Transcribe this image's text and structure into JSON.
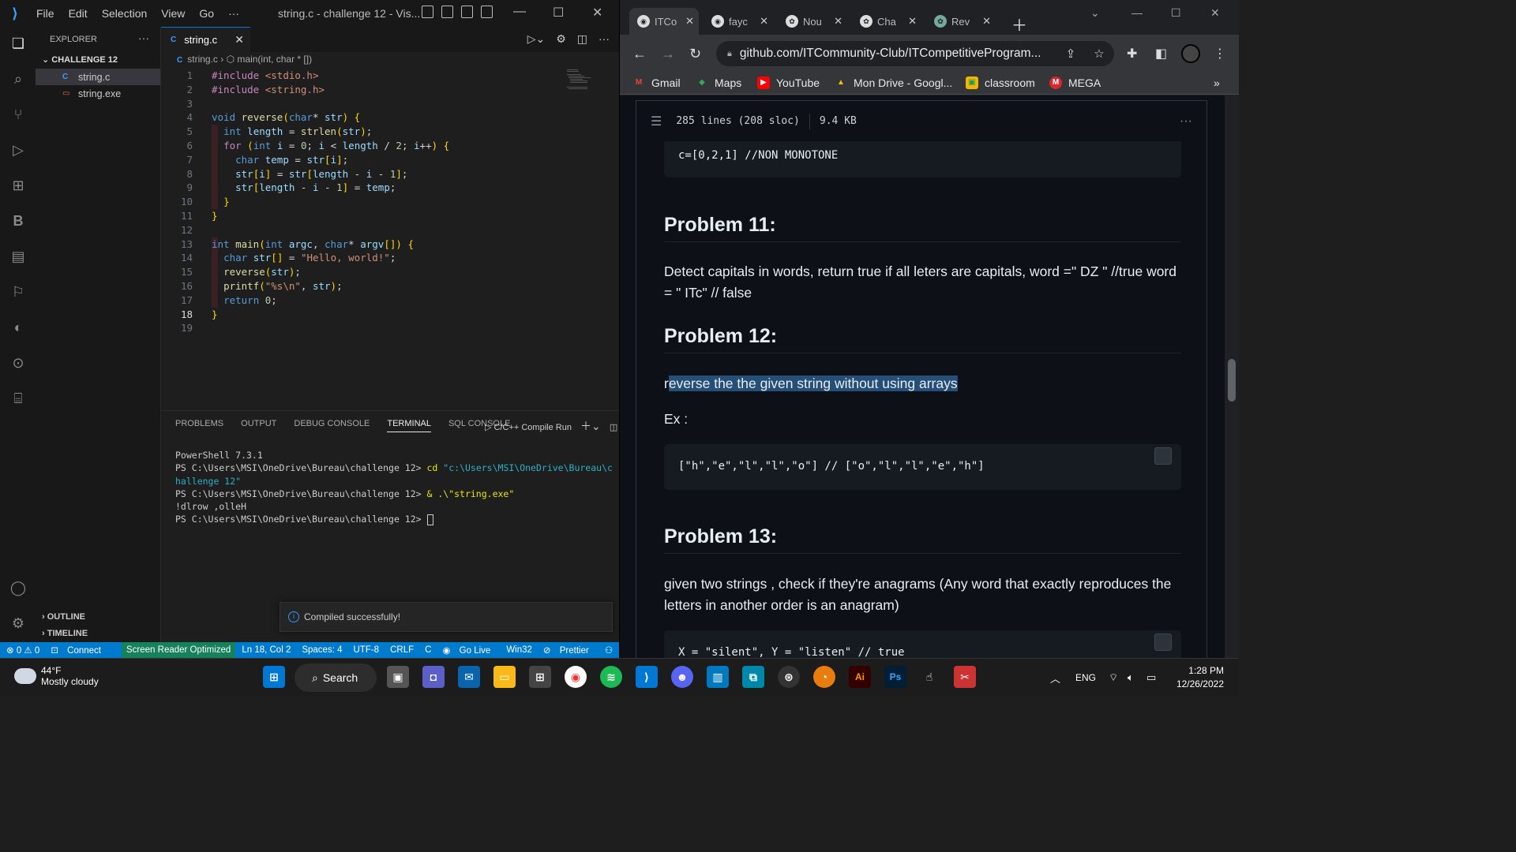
{
  "vscode": {
    "menu": [
      "File",
      "Edit",
      "Selection",
      "View",
      "Go",
      "···"
    ],
    "window_title": "string.c - challenge 12 - Vis...",
    "explorer": {
      "header": "EXPLORER",
      "folder": "CHALLENGE 12",
      "files": [
        {
          "name": "string.c",
          "icon": "C"
        },
        {
          "name": "string.exe",
          "icon": "exe"
        }
      ],
      "outline": "OUTLINE",
      "timeline": "TIMELINE"
    },
    "tab": {
      "label": "string.c",
      "icon": "C"
    },
    "breadcrumb": {
      "file": "string.c",
      "symbol": "main(int, char * [])"
    },
    "code_lines": [
      "#include <stdio.h>",
      "#include <string.h>",
      "",
      "void reverse(char* str) {",
      "  int length = strlen(str);",
      "  for (int i = 0; i < length / 2; i++) {",
      "    char temp = str[i];",
      "    str[i] = str[length - i - 1];",
      "    str[length - i - 1] = temp;",
      "  }",
      "}",
      "",
      "int main(int argc, char* argv[]) {",
      "  char str[] = \"Hello, world!\";",
      "  reverse(str);",
      "  printf(\"%s\\n\", str);",
      "  return 0;",
      "}",
      ""
    ],
    "current_line": 18,
    "panel": {
      "tabs": [
        "PROBLEMS",
        "OUTPUT",
        "DEBUG CONSOLE",
        "TERMINAL",
        "SQL CONSOLE"
      ],
      "active_tab": "TERMINAL",
      "task": "C/C++ Compile Run",
      "terminal": {
        "l1": "PowerShell 7.3.1",
        "l2_prompt": "PS C:\\Users\\MSI\\OneDrive\\Bureau\\challenge 12> ",
        "l2_cmd": "cd",
        "l2_arg": " \"c:\\Users\\MSI\\OneDrive\\Bureau\\challenge 12\"",
        "l3_prompt": "PS C:\\Users\\MSI\\OneDrive\\Bureau\\challenge 12> ",
        "l3_cmd": "& .\\\"string.exe\"",
        "l4": "!dlrow ,olleH",
        "l5_prompt": "PS C:\\Users\\MSI\\OneDrive\\Bureau\\challenge 12> "
      }
    },
    "toast": "Compiled successfully!",
    "status": {
      "problems": "⊗ 0 ⚠ 0",
      "connect": "Connect",
      "reader": "Screen Reader Optimized",
      "position": "Ln 18, Col 2",
      "spaces": "Spaces: 4",
      "encoding": "UTF-8",
      "eol": "CRLF",
      "lang": "C",
      "golive": "Go Live",
      "platform": "Win32",
      "prettier": "Prettier"
    }
  },
  "chrome": {
    "tabs": [
      {
        "label": "ITCo",
        "icon": "github-icon",
        "active": true
      },
      {
        "label": "fayc",
        "icon": "github-icon"
      },
      {
        "label": "Nou",
        "icon": "chatgpt-icon"
      },
      {
        "label": "Cha",
        "icon": "chatgpt-icon"
      },
      {
        "label": "Rev",
        "icon": "chatgpt-icon"
      }
    ],
    "url": "github.com/ITCommunity-Club/ITCompetitiveProgram...",
    "bookmarks": [
      {
        "label": "Gmail",
        "color": "#ea4335",
        "glyph": "M"
      },
      {
        "label": "Maps",
        "color": "#34a853",
        "glyph": "◆"
      },
      {
        "label": "YouTube",
        "color": "#ff0000",
        "glyph": "▶"
      },
      {
        "label": "Mon Drive - Googl...",
        "color": "#fbbc04",
        "glyph": "▲"
      },
      {
        "label": "classroom",
        "color": "#f4b400",
        "glyph": "▣"
      },
      {
        "label": "MEGA",
        "color": "#d9272e",
        "glyph": "M"
      }
    ],
    "file_info": {
      "lines": "285 lines (208 sloc)",
      "size": "9.4 KB"
    },
    "content": {
      "prev_code": "c=[0,2,1] //NON MONOTONE",
      "p11_title": "Problem 11:",
      "p11_text": "Detect capitals in words, return true if all leters are capitals, word =\" DZ \" //true word = \" ITc\" // false",
      "p12_title": "Problem 12:",
      "p12_prefix": "r",
      "p12_highlight": "everse the the given string without using arrays",
      "ex": "Ex :",
      "p12_code": "[\"h\",\"e\",\"l\",\"l\",\"o\"] // [\"o\",\"l\",\"l\",\"e\",\"h\"]",
      "p13_title": "Problem 13:",
      "p13_text": "given two strings , check if they're anagrams (Any word that exactly reproduces the letters in another order is an anagram)",
      "p13_code": "X = \"silent\", Y = \"listen\" // true"
    }
  },
  "taskbar": {
    "temp": "44°F",
    "weather": "Mostly cloudy",
    "search": "Search",
    "lang": "ENG",
    "time": "1:28 PM",
    "date": "12/26/2022"
  }
}
